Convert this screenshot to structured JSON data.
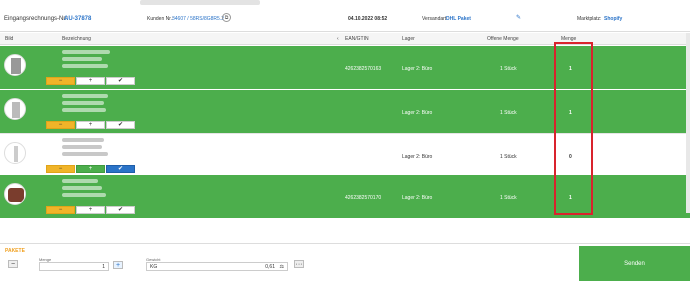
{
  "header": {
    "order_label": "Eingangsrechnungs-Nr.:",
    "order_number": "AU-37878",
    "customer_label": "Kunden Nr.:",
    "customer_value": "34607 / 58RS/8G8R5.2",
    "date": "04.10.2022 08:52",
    "shipping_label": "Versandart:",
    "shipping_value": "DHL Paket",
    "marketplace_label": "Marktplatz:",
    "marketplace_value": "Shopify"
  },
  "table": {
    "columns": [
      "Bild",
      "Bezeichnung",
      "EAN/GTIN",
      "Lager",
      "Offene Menge",
      "Menge"
    ],
    "rows": [
      {
        "ean": "4262382570163",
        "lager": "Lager 2: Büro",
        "offen": "1 Stück",
        "menge": "1"
      },
      {
        "ean": "",
        "lager": "Lager 2: Büro",
        "offen": "1 Stück",
        "menge": "1"
      },
      {
        "ean": "",
        "lager": "Lager 2: Büro",
        "offen": "1 Stück",
        "menge": "0"
      },
      {
        "ean": "4262382570170",
        "lager": "Lager 2: Büro",
        "offen": "1 Stück",
        "menge": "1"
      }
    ],
    "btn_minus": "−",
    "btn_plus": "+",
    "btn_check": "✔"
  },
  "footer": {
    "title": "PAKETE",
    "menge_label": "Menge",
    "menge_value": "1",
    "gewicht_label": "Gewicht",
    "gewicht_unit": "KG",
    "gewicht_value": "0,61",
    "send_label": "Senden"
  },
  "colors": {
    "green": "#4cae4c",
    "yellow": "#f0b429",
    "blue": "#2a73c8",
    "red": "#d9232d"
  }
}
